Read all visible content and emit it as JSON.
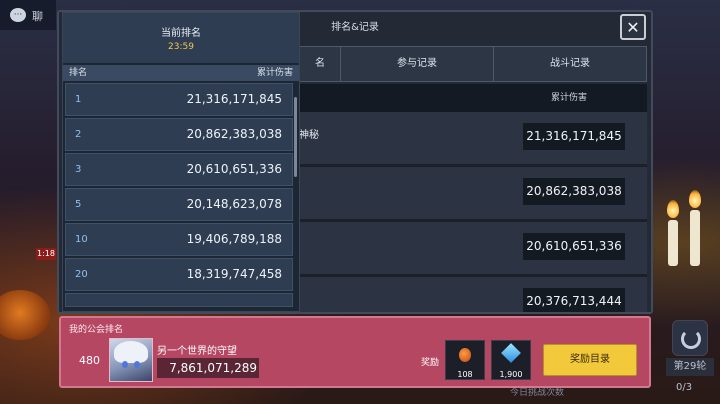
{
  "background": {
    "chat_label": "聊",
    "red_tag": "1:18",
    "round_label": "第29轮",
    "counter": "0/3",
    "bottom_hint": "今日挑战次数"
  },
  "modal": {
    "title": "排名&记录",
    "tabs": [
      "名",
      "参与记录",
      "战斗记录"
    ],
    "list_header": "累计伤害",
    "rows": [
      {
        "name": "神秘",
        "value": "21,316,171,845"
      },
      {
        "name": "",
        "value": "20,862,383,038"
      },
      {
        "name": "",
        "value": "20,610,651,336"
      },
      {
        "name": "",
        "value": "20,376,713,444"
      }
    ],
    "close_symbol": "✕"
  },
  "popup": {
    "title": "当前排名",
    "timer": "23:59",
    "col_rank": "排名",
    "col_damage": "累计伤害",
    "rows": [
      {
        "rank": "1",
        "damage": "21,316,171,845"
      },
      {
        "rank": "2",
        "damage": "20,862,383,038"
      },
      {
        "rank": "3",
        "damage": "20,610,651,336"
      },
      {
        "rank": "5",
        "damage": "20,148,623,078"
      },
      {
        "rank": "10",
        "damage": "19,406,789,188"
      },
      {
        "rank": "20",
        "damage": "18,319,747,458"
      }
    ]
  },
  "guild": {
    "label": "我的公会排名",
    "rank": "480",
    "name": "另一个世界的守望",
    "damage": "7,861,071,289",
    "reward_label": "奖励",
    "rewards": [
      {
        "icon": "bag-icon",
        "qty": "108"
      },
      {
        "icon": "gem-icon",
        "qty": "1,900"
      }
    ],
    "reward_button": "奖励目录"
  },
  "colors": {
    "guild_bar": "#b64763",
    "reward_button": "#f2c93a",
    "timer": "#f0c850"
  }
}
